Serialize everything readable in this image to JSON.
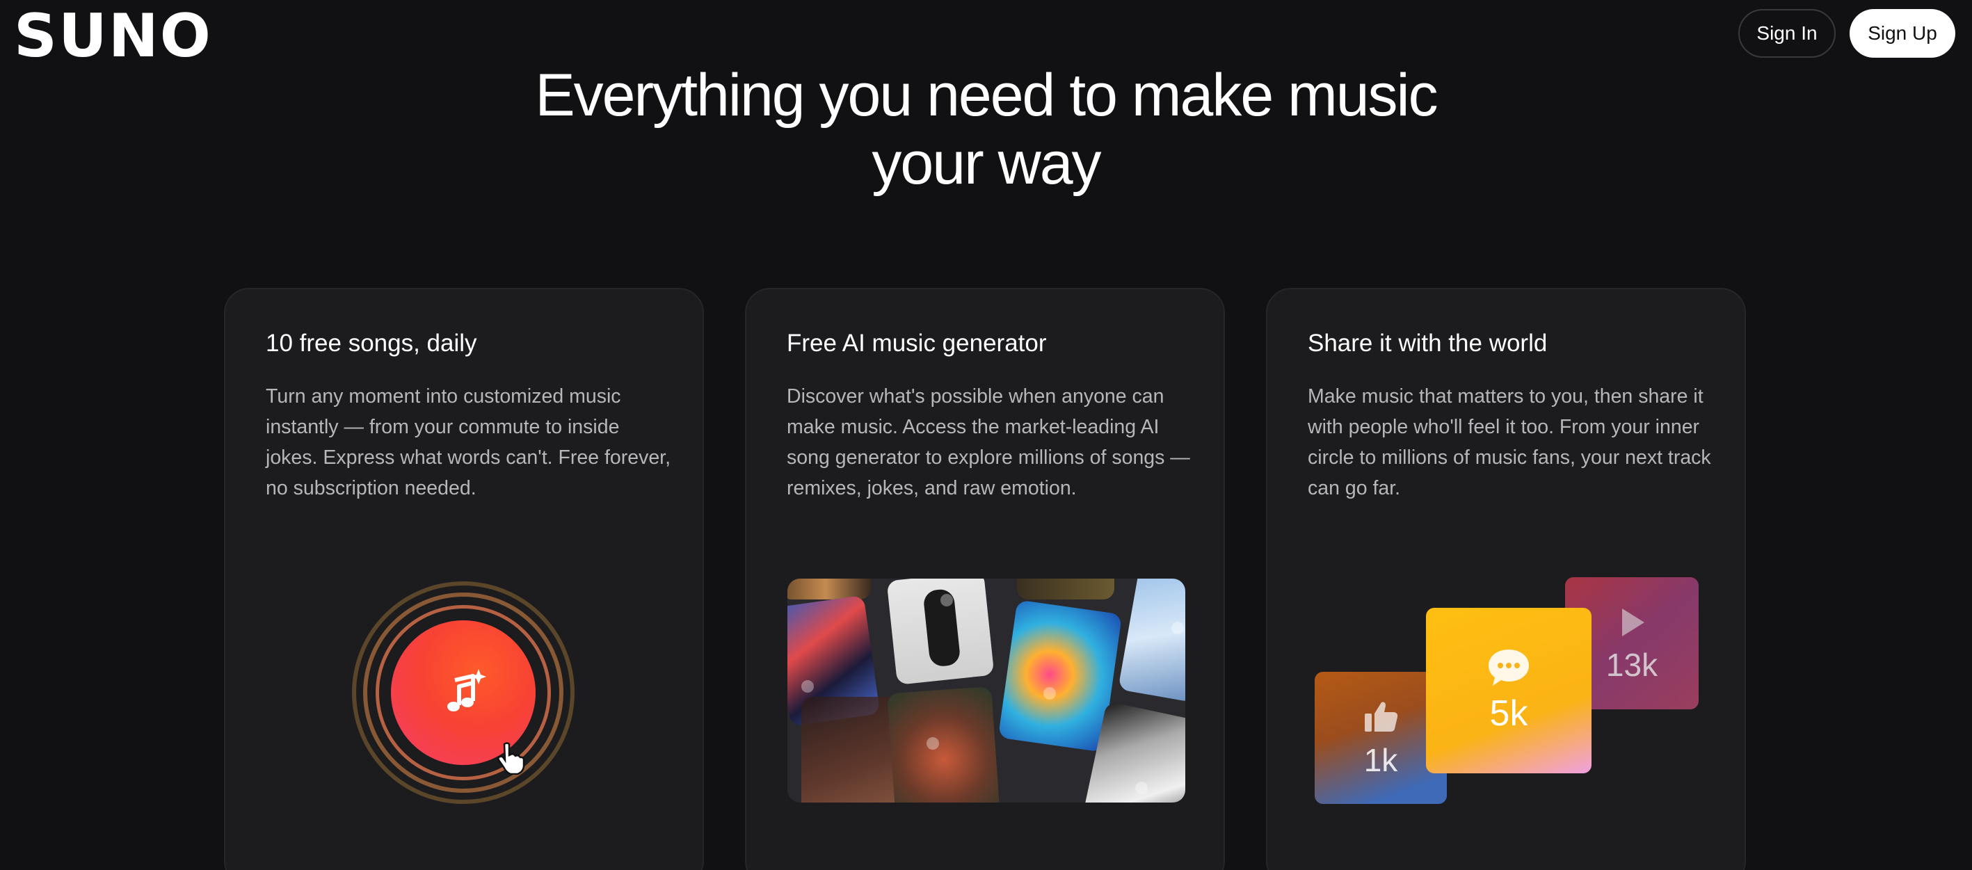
{
  "header": {
    "logo": "SUNO",
    "sign_in_label": "Sign In",
    "sign_up_label": "Sign Up"
  },
  "hero": {
    "title_line1": "Everything you need to make music",
    "title_line2": "your way"
  },
  "cards": [
    {
      "title": "10 free songs, daily",
      "description": "Turn any moment into customized music instantly — from your commute to inside jokes. Express what words can't. Free forever, no subscription needed.",
      "icon": "music-note-sparkle-icon"
    },
    {
      "title": "Free AI music generator",
      "description": "Discover what's possible when anyone can make music. Access the market-leading AI song generator to explore millions of songs —remixes, jokes, and raw emotion."
    },
    {
      "title": "Share it with the world",
      "description": "Make music that matters to you, then share it with people who'll feel it too. From your inner circle to millions of music fans, your next track can go far.",
      "stats": {
        "likes": "1k",
        "comments": "5k",
        "plays": "13k"
      }
    }
  ],
  "colors": {
    "background": "#111113",
    "card": "#1c1c1f",
    "disc_orange": "#f84234",
    "comments_yellow": "#ffbf12"
  }
}
